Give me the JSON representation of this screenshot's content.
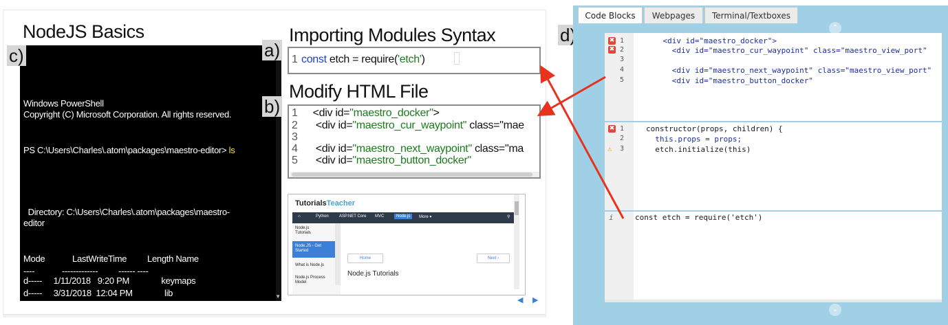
{
  "left": {
    "title_nodejs": "NodeJS Basics",
    "title_import": "Importing Modules Syntax",
    "title_modify": "Modify HTML File",
    "label_a": "a)",
    "label_b": "b)",
    "label_c": "c)",
    "label_d": "d)",
    "terminal": {
      "line1": "Windows PowerShell",
      "line2": "Copyright (C) Microsoft Corporation. All rights reserved.",
      "prompt": "PS C:\\Users\\Charles\\.atom\\packages\\maestro-editor> ",
      "command": "ls",
      "dir1": "  Directory: C:\\Users\\Charles\\.atom\\packages\\maestro-",
      "dir2": "editor",
      "header": "Mode            LastWriteTime         Length Name",
      "sep": "----            -------------         ------ ----",
      "row1": "d-----     1/11/2018   9:20 PM              keymaps",
      "row2": "d-----     3/31/2018  12:04 PM              lib"
    },
    "code_a": {
      "num": "1",
      "kw": "const",
      "rest": " etch = require(",
      "str": "'etch'",
      "end": ")"
    },
    "code_b": {
      "lines": [
        {
          "num": "1",
          "pre": "    <div id=",
          "str": "\"maestro_docker\"",
          "post": ">"
        },
        {
          "num": "2",
          "pre": "     <div id=",
          "str": "\"maestro_cur_waypoint\"",
          "post": " class=\"mae"
        },
        {
          "num": "3",
          "pre": "",
          "str": "",
          "post": ""
        },
        {
          "num": "4",
          "pre": "     <div id=",
          "str": "\"maestro_next_waypoint\"",
          "post": " class=\"ma"
        },
        {
          "num": "5",
          "pre": "     <div id=",
          "str": "\"maestro_button_docker\"",
          "post": ""
        }
      ]
    },
    "browser": {
      "logo_a": "Tutorials",
      "logo_b": "Teacher",
      "nav": [
        "Python",
        "ASP.NET Core",
        "MVC",
        "Node.js",
        "More ▾"
      ],
      "side": [
        "Node.js Tutorials",
        "Node.JS - Get Started",
        "What is Node.js",
        "Node.js Process Model"
      ],
      "home_btn": "Home",
      "next_btn": "Next ›",
      "heading": "Node.js Tutorials"
    },
    "ctrl_prev": "◀",
    "ctrl_next": "▶"
  },
  "right": {
    "tabs": [
      "Code Blocks",
      "Webpages",
      "Terminal/Textboxes"
    ],
    "editor1": [
      "    <div id=\"maestro_docker\">",
      "      <div id=\"maestro_cur_waypoint\" class=\"maestro_view_port\"",
      "",
      "      <div id=\"maestro_next_waypoint\" class=\"maestro_view_port\"",
      "      <div id=\"maestro_button_docker\""
    ],
    "editor1_nums": [
      "1",
      "2",
      "3",
      "4",
      "5"
    ],
    "editor2": [
      "constructor(props, children) {",
      "  this.props = props;",
      "  etch.initialize(this)"
    ],
    "editor2_nums": [
      "1",
      "2",
      "3"
    ],
    "editor3": [
      "const etch = require('etch')"
    ],
    "error_glyph": "✖",
    "warn_glyph": "⚠",
    "info_glyph": "i",
    "collapse_up": "⌃",
    "collapse_down": "⌄"
  },
  "colors": {
    "arrow": "#e8321e",
    "panel_blue": "#9fd0e6"
  }
}
